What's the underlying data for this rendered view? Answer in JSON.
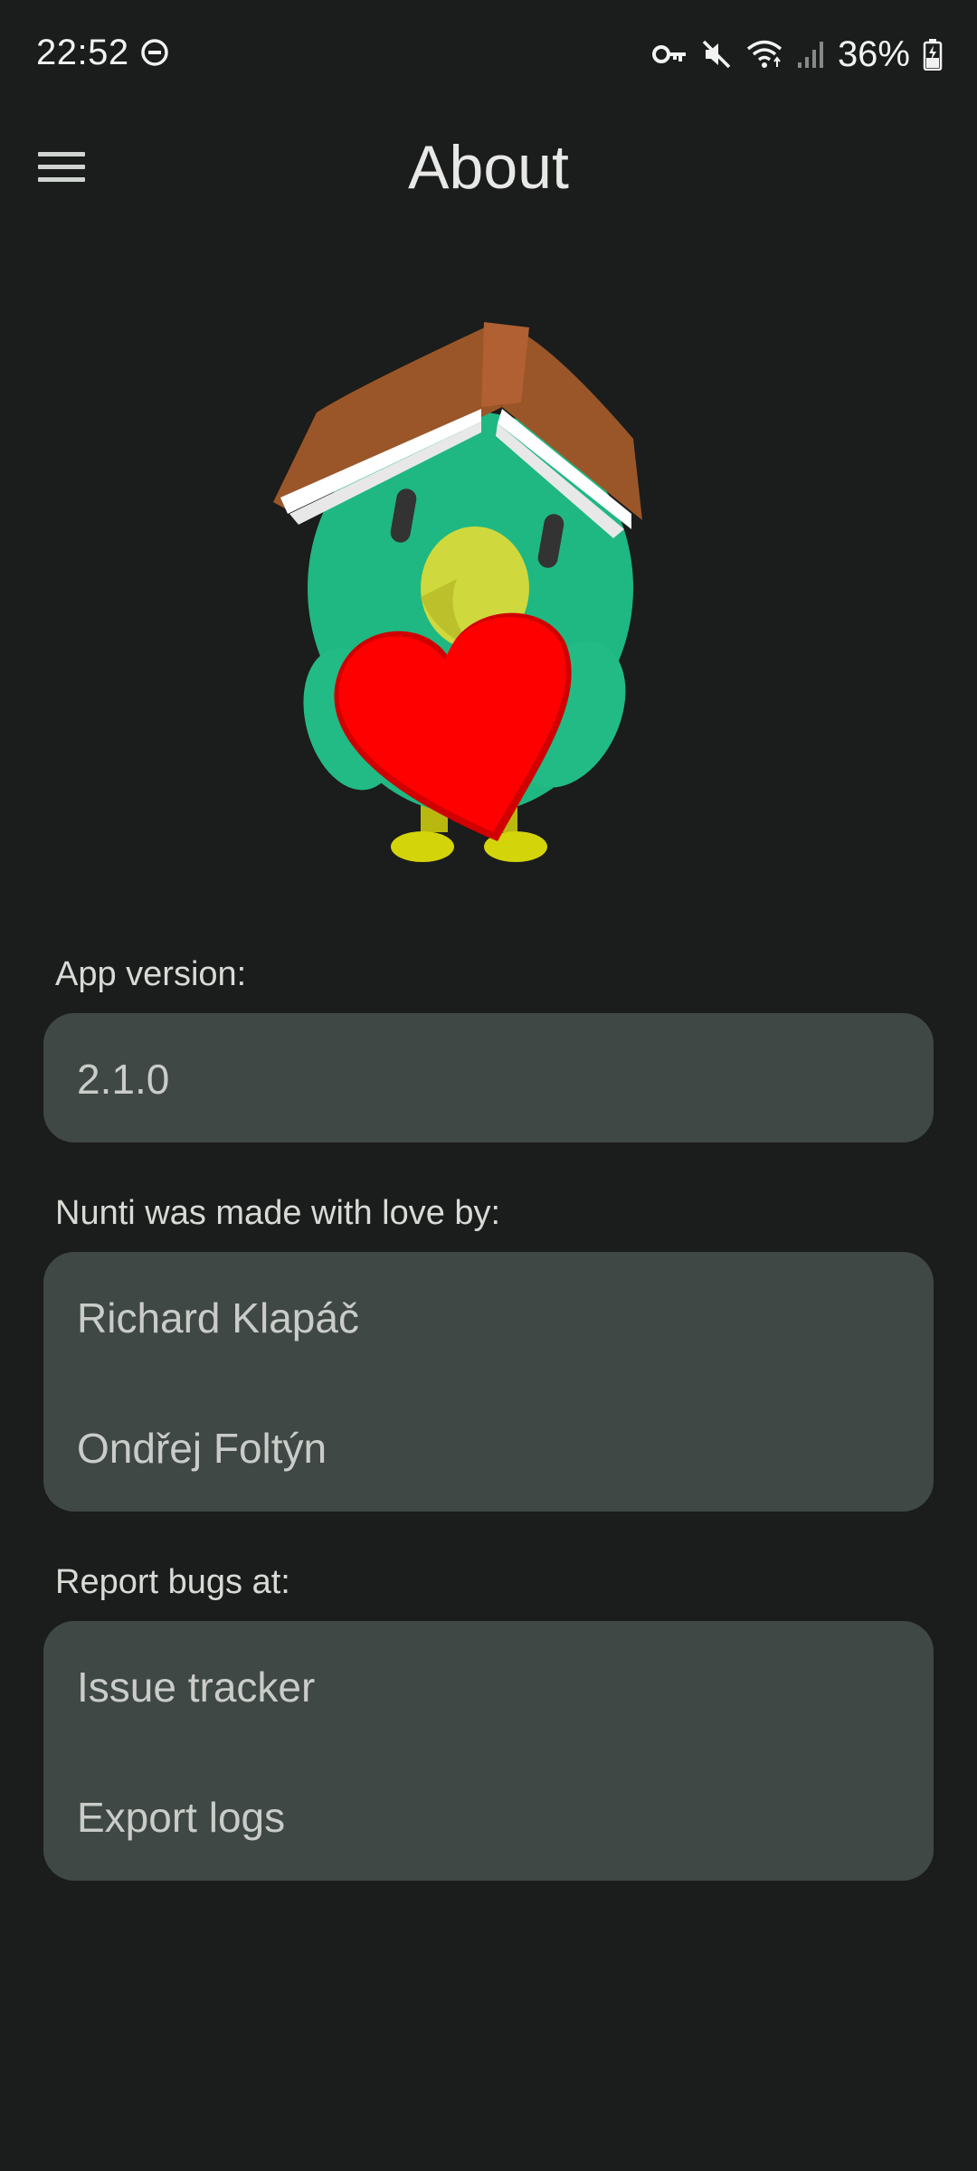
{
  "status_bar": {
    "time": "22:52",
    "battery_percent": "36%",
    "icons": [
      "do-not-disturb-icon",
      "vpn-key-icon",
      "mute-icon",
      "wifi-icon",
      "signal-icon",
      "battery-charging-icon"
    ]
  },
  "app_bar": {
    "title": "About",
    "menu_icon": "hamburger-menu-icon"
  },
  "mascot": {
    "description_icon": "bird-with-book-and-heart-icon"
  },
  "version_section": {
    "label": "App version:",
    "value": "2.1.0"
  },
  "authors_section": {
    "label": "Nunti was made with love by:",
    "authors": [
      "Richard Klapáč",
      "Ondřej Foltýn"
    ]
  },
  "bugs_section": {
    "label": "Report bugs at:",
    "items": [
      "Issue tracker",
      "Export logs"
    ]
  },
  "colors": {
    "background": "#1b1c1c",
    "card": "#404846",
    "text_primary": "#e8e8e6",
    "text_card": "#c9ccc8"
  }
}
